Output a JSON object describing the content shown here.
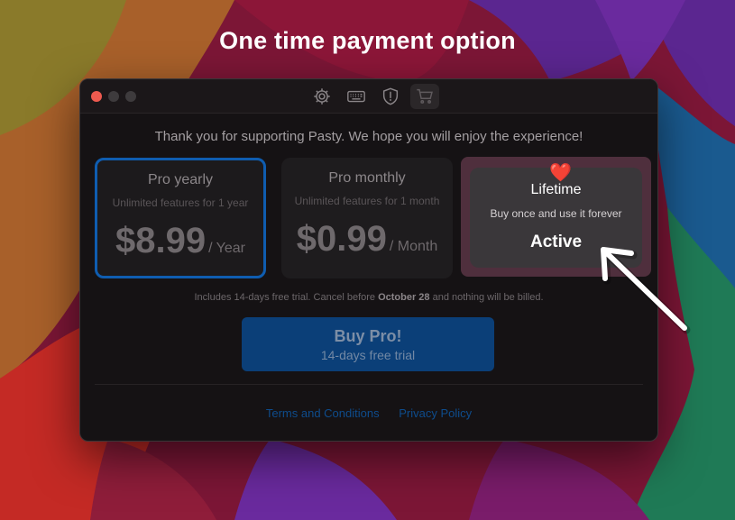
{
  "headline": "One time payment option",
  "toolbar": {
    "items": [
      {
        "icon": "gear-icon",
        "active": false
      },
      {
        "icon": "keyboard-icon",
        "active": false
      },
      {
        "icon": "shield-alert-icon",
        "active": false
      },
      {
        "icon": "cart-icon",
        "active": true
      }
    ]
  },
  "thanks_text": "Thank you for supporting Pasty. We hope you will enjoy the experience!",
  "plans": {
    "yearly": {
      "title": "Pro yearly",
      "subtitle": "Unlimited features for 1 year",
      "price": "$8.99",
      "unit": "/ Year"
    },
    "monthly": {
      "title": "Pro monthly",
      "subtitle": "Unlimited features for 1 month",
      "price": "$0.99",
      "unit": "/ Month"
    },
    "lifetime": {
      "badge": "❤️",
      "title": "Lifetime",
      "subtitle": "Buy once and use it forever",
      "status": "Active"
    }
  },
  "trial_note": {
    "before": "Includes 14-days free trial. Cancel before ",
    "date": "October 28",
    "after": " and nothing will be billed."
  },
  "buy_button": {
    "title": "Buy Pro!",
    "subtitle": "14-days free trial"
  },
  "links": {
    "terms": "Terms and Conditions",
    "privacy": "Privacy Policy"
  },
  "colors": {
    "accent_blue": "#0f5db0",
    "close_red": "#ee5a4f",
    "lifetime_highlight": "#4f2f3d"
  }
}
